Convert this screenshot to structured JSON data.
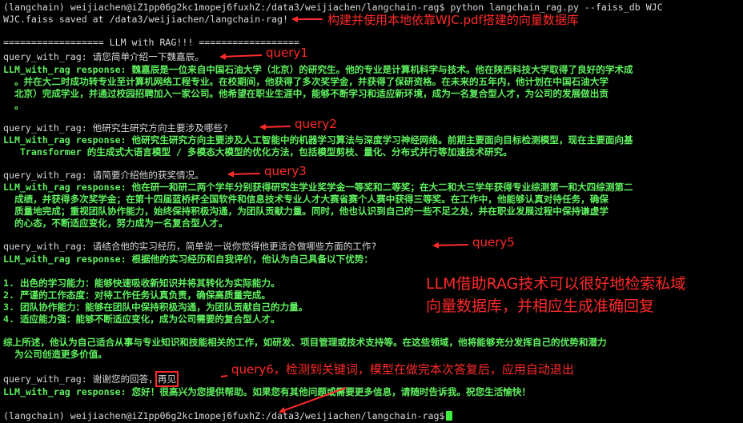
{
  "terminal": {
    "lines": [
      "(langchain) weijiachen@iZ1pp06g2kc1mopej6fuxhZ:/data3/weijiachen/langchain-rag$ python langchain_rag.py --faiss_db WJC",
      "WJC.faiss saved at /data3/weijiachen/langchain-rag!",
      "================== LLM with RAG!!! ==================",
      "query_with_rag: 请您简单介绍一下魏嘉辰。",
      "LLM_with_rag response: 魏嘉辰是一位来自中国石油大学（北京）的研究生。他的专业是计算机科学与技术。他在陕西科技大学取得了良好的学术成",
      "  。并在大二时成功转专业至计算机网络工程专业。在校期间，他获得了多次奖学金，并获得了保研资格。在未来的五年内，他计划在中国石油大学",
      "  北京）完成学业，并通过校园招聘加入一家公司。他希望在职业生涯中，能够不断学习和适应新环境，成为一名复合型人才，为公司的发展做出贡",
      "  。",
      "query_with_rag: 他研究生研究方向主要涉及哪些?",
      "LLM_with_rag response: 他研究生研究方向主要涉及人工智能中的机器学习算法与深度学习神经网络。前期主要面向目标检测模型，现在主要面向基",
      "   Transformer 的生成式大语言模型 / 多模态大模型的优化方法，包括模型剪枝、量化、分布式并行等加速技术研究。",
      "query_with_rag: 请简要介绍他的获奖情况。",
      "LLM_with_rag response: 他在研一和研二两个学年分别获得研究生学业奖学金一等奖和二等奖；在大二和大三学年获得专业综测第一和大四综测第二",
      "  成绩，并获得多次奖学金；在第十四届蓝桥杯全国软件和信息技术专业人才大赛省赛个人赛中获得三等奖。在工作中，他能够认真对待任务，确保",
      "  质量地完成；重视团队协作能力，始终保持积极沟通，为团队贡献力量。同时，他也认识到自己的一些不足之处，并在职业发展过程中保持谦虚学",
      "  的心态，不断适应变化，努力成为一名复合型人才。",
      "query_with_rag: 请结合他的实习经历，简单说一说你觉得他更适合做哪些方面的工作?",
      "LLM_with_rag response: 根据他的实习经历和自我评价，他认为自己具备以下优势：",
      "1. 出色的学习能力：能够快速吸收新知识并将其转化为实际能力。",
      "2. 严谨的工作态度：对待工作任务认真负责，确保高质量完成。",
      "3. 团队协作能力：能够在团队中保持积极沟通，为团队贡献自己的力量。",
      "4. 适应能力强：能够不断适应变化，成为公司需要的复合型人才。",
      "综上所述，他认为自己适合从事与专业知识和技能相关的工作，如研发、项目管理或技术支持等。在这些领域，他将能够充分发挥自己的优势和潜力",
      "  为公司创造更多价值。",
      "query_with_rag: 谢谢您的回答，",
      "再见",
      "LLM_with_rag response: 您好！很高兴为您提供帮助。如果您有其他问题或需要更多信息，请随时告诉我。祝您生活愉快！",
      "(langchain) weijiachen@iZ1pp06g2kc1mopej6fuxhZ:/data3/weijiachen/langchain-rag$"
    ]
  },
  "annotations": {
    "faiss": "构建并使用本地依靠WJC.pdf搭建的向量数据库",
    "query1": "query1",
    "query2": "query2",
    "query3": "query3",
    "query5": "query5",
    "summary_line1": "LLM借助RAG技术可以很好地检索私域",
    "summary_line2": "向量数据库，并相应生成准确回复",
    "query6": "query6，检测到关键词，模型在做完本次答复后，应用自动退出"
  },
  "colors": {
    "background": "#000000",
    "plain_text": "#d8d8d8",
    "llm_text": "#5ef05e",
    "annotation": "#ff2a2a"
  }
}
